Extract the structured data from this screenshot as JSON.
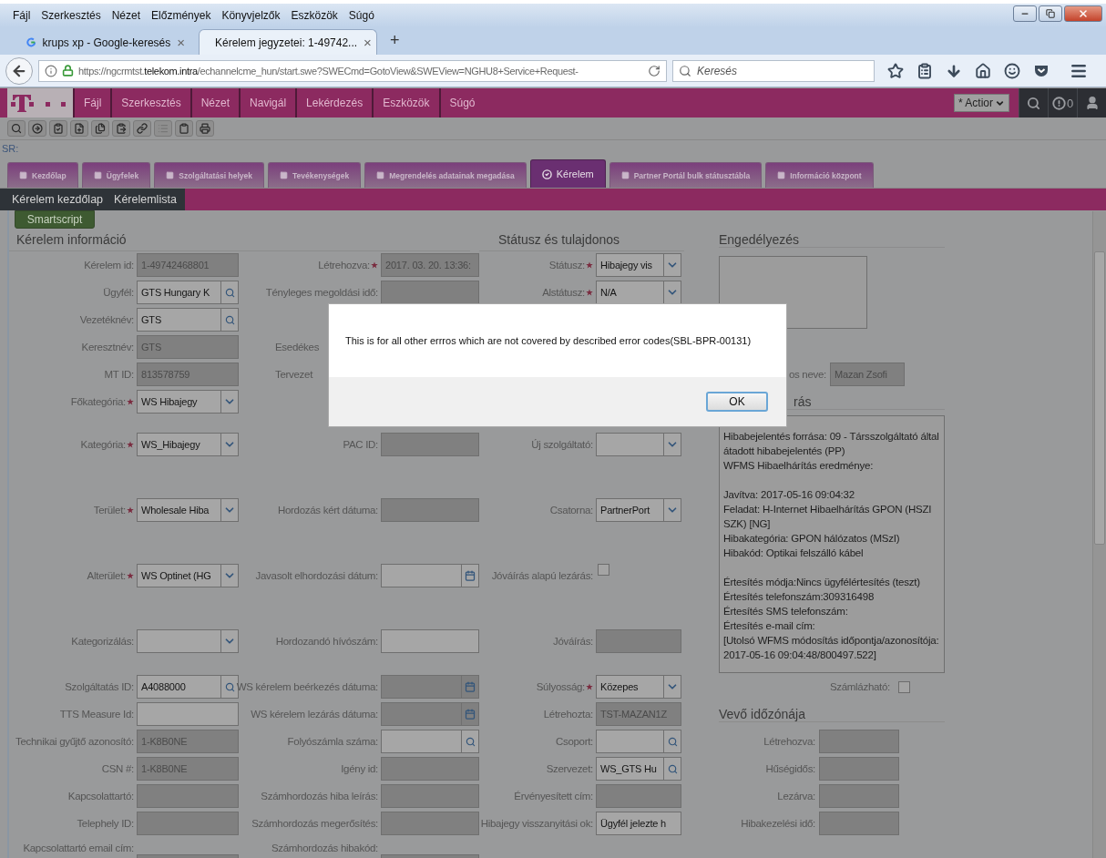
{
  "browser": {
    "menu": [
      "Fájl",
      "Szerkesztés",
      "Nézet",
      "Előzmények",
      "Könyvjelzők",
      "Eszközök",
      "Súgó"
    ],
    "tabs": [
      {
        "title": "krups xp - Google-keresés",
        "close": "×",
        "selected": false
      },
      {
        "title": "Kérelem jegyzetei: 1-49742...",
        "close": "×",
        "selected": true
      }
    ],
    "new_tab": "+",
    "url": "https://ngcrmtst.**telekom.intra**/echannelcme_hun/start.swe?SWECmd=GotoView&SWEView=NGHU8+Service+Request-",
    "search": {
      "placeholder": "Keresés"
    }
  },
  "app": {
    "menu": [
      "Fájl",
      "Szerkesztés",
      "Nézet",
      "Navigál",
      "Lekérdezés",
      "Eszközök",
      "Súgó"
    ],
    "actions": "* Actior",
    "notifications": "0",
    "record_label": "SR:",
    "screen_tabs": [
      {
        "label": "Kezdőlap",
        "selected": false
      },
      {
        "label": "Ügyfelek",
        "selected": false
      },
      {
        "label": "Szolgáltatási helyek",
        "selected": false
      },
      {
        "label": "Tevékenységek",
        "selected": false
      },
      {
        "label": "Megrendelés adatainak megadása",
        "selected": false
      },
      {
        "label": "Kérelem",
        "selected": true
      },
      {
        "label": "Partner Portál bulk státusztábla",
        "selected": false
      },
      {
        "label": "Információ központ",
        "selected": false
      }
    ],
    "view_tabs": [
      "Kérelem kezdőlap",
      "Kérelemlista"
    ],
    "smartscript": "Smartscript"
  },
  "form": {
    "headings": [
      "Kérelem információ",
      "Státusz és tulajdonos"
    ],
    "rows": [
      {
        "left": {
          "label": "Kérelem id:",
          "value": "1-49742468801",
          "kind": "text",
          "readonly": true
        },
        "middle": {
          "label": "Létrehozva:",
          "required": true,
          "value": "2017. 03. 20. 13:36:",
          "kind": "text",
          "readonly": true
        },
        "right": {
          "label": "Státusz:",
          "required": true,
          "value": "Hibajegy vis",
          "kind": "select",
          "readonly": false
        }
      },
      {
        "left": {
          "label": "Ügyfél:",
          "value": "GTS Hungary K",
          "kind": "lookup",
          "readonly": false
        },
        "middle": {
          "label": "Tényleges megoldási idő:",
          "kind": "text",
          "readonly": true
        },
        "right": {
          "label": "Alstátusz:",
          "required": true,
          "value": "N/A",
          "kind": "select",
          "readonly": false
        }
      },
      {
        "left": {
          "label": "Vezetéknév:",
          "value": "GTS",
          "kind": "lookup",
          "readonly": false
        }
      },
      {
        "left": {
          "label": "Keresztnév:",
          "value": "GTS",
          "kind": "text",
          "readonly": true
        },
        "middle": {
          "label": "Esedékes",
          "kind": "covered"
        }
      },
      {
        "left": {
          "label": "MT ID:",
          "value": "813578759",
          "kind": "text",
          "readonly": true
        },
        "middle": {
          "label": "Tervezet",
          "kind": "covered"
        }
      },
      {
        "left": {
          "label": "Főkategória:",
          "required": true,
          "value": "WS Hibajegy",
          "kind": "select",
          "readonly": false
        }
      },
      {
        "left": {
          "label": "Kategória:",
          "required": true,
          "value": "WS_Hibajegy",
          "kind": "select",
          "readonly": false
        },
        "middle": {
          "label": "PAC ID:",
          "kind": "text",
          "readonly": true
        },
        "right": {
          "label": "Új szolgáltató:",
          "kind": "select",
          "readonly": false
        }
      },
      {
        "left": {
          "label": "Terület:",
          "required": true,
          "value": "Wholesale Hiba",
          "kind": "select",
          "readonly": false
        },
        "middle": {
          "label": "Hordozás kért dátuma:",
          "kind": "text",
          "readonly": true
        },
        "right": {
          "label": "Csatorna:",
          "value": "PartnerPort",
          "kind": "select",
          "readonly": false
        }
      },
      {
        "left": {
          "label": "Alterület:",
          "required": true,
          "value": "WS Optinet (HG",
          "kind": "select",
          "readonly": false
        },
        "middle": {
          "label": "Javasolt elhordozási dátum:",
          "kind": "date",
          "readonly": false
        },
        "right": {
          "label": "Jóváírás alapú lezárás:",
          "kind": "checkbox",
          "checked": false
        }
      },
      {
        "left": {
          "label": "Kategorizálás:",
          "kind": "select",
          "readonly": false
        },
        "middle": {
          "label": "Hordozandó hívószám:",
          "kind": "text",
          "readonly": false
        },
        "right": {
          "label": "Jóváírás:",
          "kind": "text",
          "readonly": true
        }
      },
      {
        "left": {
          "label": "Szolgáltatás ID:",
          "value": "A4088000",
          "kind": "lookup",
          "readonly": false
        },
        "middle": {
          "label": "WS kérelem beérkezés dátuma:",
          "kind": "date",
          "readonly": true
        },
        "right": {
          "label": "Súlyosság:",
          "required": true,
          "value": "Közepes",
          "kind": "select",
          "readonly": false
        }
      },
      {
        "left": {
          "label": "TTS Measure Id:",
          "kind": "text",
          "readonly": false
        },
        "middle": {
          "label": "WS kérelem lezárás dátuma:",
          "kind": "date",
          "readonly": true
        },
        "right": {
          "label": "Létrehozta:",
          "value": "TST-MAZAN1Z",
          "kind": "text",
          "readonly": true
        }
      },
      {
        "left": {
          "label": "Technikai gyűjtő azonosító:",
          "value": "1-K8B0NE",
          "kind": "text",
          "readonly": true
        },
        "middle": {
          "label": "Folyószámla száma:",
          "kind": "lookup",
          "readonly": false
        },
        "right": {
          "label": "Csoport:",
          "kind": "lookup",
          "readonly": false
        }
      },
      {
        "left": {
          "label": "CSN #:",
          "value": "1-K8B0NE",
          "kind": "text",
          "readonly": true
        },
        "middle": {
          "label": "Igény id:",
          "kind": "text",
          "readonly": true
        },
        "right": {
          "label": "Szervezet:",
          "value": "WS_GTS Hu",
          "kind": "lookup",
          "readonly": false
        }
      },
      {
        "left": {
          "label": "Kapcsolattartó:",
          "kind": "text",
          "readonly": true
        },
        "middle": {
          "label": "Számhordozás hiba leírás:",
          "kind": "text",
          "readonly": true
        },
        "right": {
          "label": "Érvényesített cím:",
          "kind": "text",
          "readonly": true
        }
      },
      {
        "left": {
          "label": "Telephely ID:",
          "kind": "text",
          "readonly": true
        },
        "middle": {
          "label": "Számhordozás megerősítés:",
          "kind": "text",
          "readonly": true
        },
        "right": {
          "label": "Hibajegy visszanyitási ok:",
          "value": "Ügyfél jelezte h",
          "kind": "text",
          "readonly": false
        }
      },
      {
        "left": {
          "label": "Kapcsolattartó email cím:",
          "kind": "text",
          "readonly": true
        },
        "middle": {
          "label": "Számhordozás hibakód:",
          "kind": "text",
          "readonly": true
        }
      }
    ],
    "side": [
      {
        "kind": "heading",
        "text": "Engedélyezés"
      },
      {
        "kind": "textarea"
      },
      {
        "kind": "field_partial",
        "label": "os neve:",
        "value": "Mazan Zsofi",
        "readonly": true
      },
      {
        "kind": "heading_partial",
        "text": "rás"
      },
      {
        "kind": "textarea",
        "text": "Hibabejelentés forrása: 09 - Társszolgáltató által átadott hibabejelentés (PP)\nWFMS Hibaelhárítás eredménye:\n\nJavítva: 2017-05-16 09:04:32\nFeladat: H-Internet Hibaelhárítás GPON (HSZI SZK) [NG]\nHibakategória: GPON hálózatos (MSzI)\nHibakód: Optikai felszálló kábel\n\nÉrtesítés módja:Nincs ügyfélértesítés (teszt)\nÉrtesítés telefonszám:309316498\nÉrtesítés SMS telefonszám:\nÉrtesítés e-mail cím:\n[Utolsó WFMS módosítás időpontja/azonosítója: 2017-05-16 09:04:48/800497.522]"
      },
      {
        "kind": "checkbox",
        "label": "Számlázható:",
        "checked": false
      },
      {
        "kind": "heading",
        "text": "Vevő időzónája"
      },
      {
        "kind": "field",
        "label": "Létrehozva:",
        "readonly": true
      },
      {
        "kind": "field",
        "label": "Hűségidős:",
        "readonly": true
      },
      {
        "kind": "field",
        "label": "Lezárva:",
        "readonly": true
      },
      {
        "kind": "field",
        "label": "Hibakezelési idő:",
        "readonly": true
      }
    ]
  },
  "dialog": {
    "message": "This is for all other errros which are not covered by described error codes(SBL-BPR-00131)",
    "button": "OK"
  }
}
